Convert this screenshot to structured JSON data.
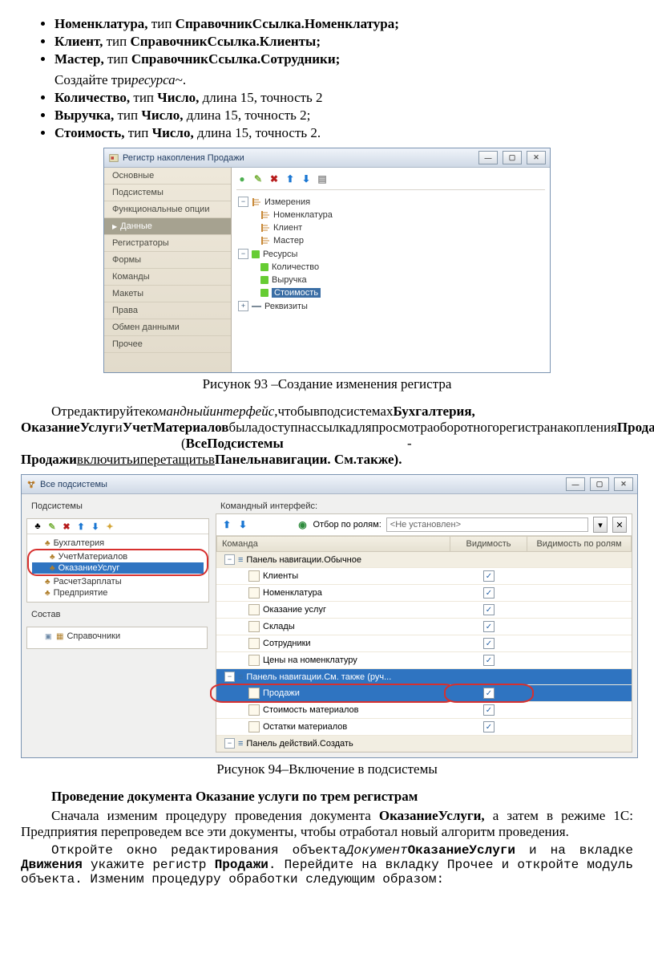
{
  "bullets1": [
    {
      "b1": "Номенклатура,",
      "t": " тип ",
      "b2": "СправочникСсылка.Номенклатура;"
    },
    {
      "b1": "Клиент,",
      "t": " тип ",
      "b2": "СправочникСсылка.Клиенты;"
    },
    {
      "b1": "Мастер,",
      "t": " тип ",
      "b2": "СправочникСсылка.Сотрудники;"
    }
  ],
  "createRes": {
    "a": "Создайте три",
    "i": "ресурса",
    "b": "~."
  },
  "bullets2": [
    {
      "b1": "Количество,",
      "t": " тип ",
      "b2": "Число,",
      "rest": " длина 15, точность 2"
    },
    {
      "b1": "Выручка,",
      "t": " тип ",
      "b2": "Число,",
      "rest": " длина 15, точность 2;"
    },
    {
      "b1": "Стоимость,",
      "t": " тип ",
      "b2": "Число,",
      "rest": " длина 15, точность 2."
    }
  ],
  "fig93": {
    "title": "Регистр накопления Продажи",
    "tabs": [
      "Основные",
      "Подсистемы",
      "Функциональные опции",
      "Данные",
      "Регистраторы",
      "Формы",
      "Команды",
      "Макеты",
      "Права",
      "Обмен данными",
      "Прочее"
    ],
    "activeTab": 3,
    "tree": [
      {
        "t": "section",
        "open": true,
        "label": "Измерения",
        "icon": "dim"
      },
      {
        "t": "item",
        "label": "Номенклатура",
        "icon": "dim"
      },
      {
        "t": "item",
        "label": "Клиент",
        "icon": "dim"
      },
      {
        "t": "item",
        "label": "Мастер",
        "icon": "dim"
      },
      {
        "t": "section",
        "open": true,
        "label": "Ресурсы",
        "icon": "res"
      },
      {
        "t": "item",
        "label": "Количество",
        "icon": "res"
      },
      {
        "t": "item",
        "label": "Выручка",
        "icon": "res"
      },
      {
        "t": "item",
        "label": "Стоимость",
        "icon": "res",
        "selected": true
      },
      {
        "t": "section",
        "open": false,
        "label": "Реквизиты",
        "icon": "req"
      }
    ],
    "caption": "Рисунок 93 –Создание изменения регистра"
  },
  "para1": {
    "a": "Отредактируйте",
    "i": "командныйинтерфейс,",
    "b": "чтобывподсистемах",
    "bold": "Бухгалтерия, ОказаниеУслуг",
    "mid": "и",
    "bold2": "УчетМатериалов",
    "c": "быладоступнассылкадляпросмотраоборотногорегистранакопления",
    "bold3": "Продажи.",
    "sp": "(",
    "bold4": "ВсеПодсистемы",
    "dash": " - ",
    "bold5": "Продажи",
    "u": "включитьиперетащитьв",
    "bold6": "Панельнавигации. См.также)."
  },
  "fig94": {
    "title": "Все подсистемы",
    "leftTitle": "Подсистемы",
    "leftItems": [
      "Бухгалтерия",
      "УчетМатериалов",
      "ОказаниеУслуг",
      "РасчетЗарплаты",
      "Предприятие"
    ],
    "leftSelected": 2,
    "circled": [
      1,
      2
    ],
    "sostav": "Состав",
    "spravochniki": "Справочники",
    "rightTitle": "Командный интерфейс:",
    "roleLabel": "Отбор по ролям:",
    "roleValue": "<Не установлен>",
    "cols": [
      "Команда",
      "Видимость",
      "Видимость по ролям"
    ],
    "rows": [
      {
        "type": "section",
        "label": "Панель навигации.Обычное"
      },
      {
        "type": "cmd",
        "label": "Клиенты",
        "chk": true
      },
      {
        "type": "cmd",
        "label": "Номенклатура",
        "chk": true
      },
      {
        "type": "cmd",
        "label": "Оказание услуг",
        "chk": true
      },
      {
        "type": "cmd",
        "label": "Склады",
        "chk": true
      },
      {
        "type": "cmd",
        "label": "Сотрудники",
        "chk": true
      },
      {
        "type": "cmd",
        "label": "Цены на номенклатуру",
        "chk": true
      },
      {
        "type": "section",
        "label": "Панель навигации.См. также (руч...",
        "hl": true
      },
      {
        "type": "cmd",
        "label": "Продажи",
        "chk": true,
        "hl": true,
        "oval": true
      },
      {
        "type": "cmd",
        "label": "Стоимость материалов",
        "chk": true
      },
      {
        "type": "cmd",
        "label": "Остатки материалов",
        "chk": true
      },
      {
        "type": "section",
        "label": "Панель действий.Создать"
      }
    ],
    "caption": "Рисунок 94–Включение в подсистемы"
  },
  "h3": "Проведение документа Оказание услуги по трем регистрам",
  "para2": {
    "a": "Сначала изменим процедуру проведения документа ",
    "b": "ОказаниеУслуги,",
    "c": " а затем в режиме 1С: Предприятия перепроведем все эти документы, чтобы отработал новый алгоритм проведения."
  },
  "para3": {
    "a": "Откройте окно редактирования объекта",
    "i": "Документ",
    "b": "ОказаниеУслуги",
    "c": " и на вкладке ",
    "d": "Движения",
    "e": " укажите регистр ",
    "f": "Продажи",
    "g": ". Перейдите на вкладку Прочее и откройте модуль объекта. Изменим процедуру обработки следующим образом:"
  }
}
